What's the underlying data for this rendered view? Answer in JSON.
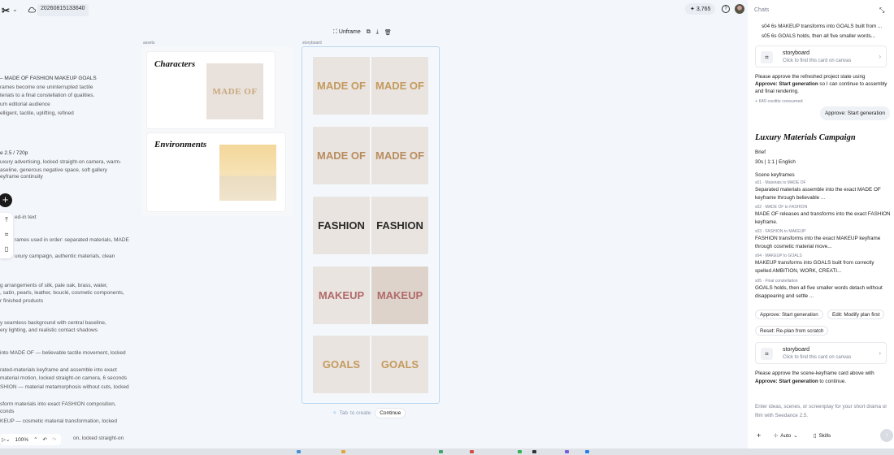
{
  "topbar": {
    "project_id": "20260815133640",
    "credits": "3,765"
  },
  "doc": {
    "lines": [
      "– MADE OF FASHION MAKEUP GOALS",
      "rames become one uninterrupted tactile",
      "terials to a final constellation of qualities.",
      "um editorial audience",
      "elligent, tactile, uplifting, refined",
      "e 2.5 / 720p",
      "uxury advertising, locked straight-on camera, warm-",
      "aseline, generous negative space, soft gallery",
      "eyframe continuity",
      "ed-in text",
      "rames used in order: separated materials, MADE",
      "uxury campaign, authentic materials, clean",
      "g arrangements of silk, pale oak, brass, water,",
      ", satin, pearls, leather, bouclé, cosmetic components,",
      "r finished products",
      "y seamless background with central baseline,",
      "ery lighting, and realistic contact shadows",
      "into MADE OF — believable tactile movement, locked",
      "rated-materials keyframe and assemble into exact",
      "material motion, locked straight-on camera, 6 seconds",
      "SHION — material metamorphosis without cuts, locked",
      "sform materials into exact FASHION composition,",
      "conds",
      "KEUP — cosmetic material transformation, locked",
      "on, locked straight-on"
    ]
  },
  "canvas": {
    "assets_label": "assets",
    "storyboard_label": "storyboard",
    "characters_title": "Characters",
    "environments_title": "Environments",
    "characters_thumb_text": "MADE OF",
    "frame_toolbar": {
      "unframe": "Unframe"
    },
    "tiles": [
      [
        "MADE OF",
        "MADE OF"
      ],
      [
        "MADE OF",
        "MADE OF"
      ],
      [
        "FASHION",
        "FASHION"
      ],
      [
        "MAKEUP",
        "MAKEUP"
      ],
      [
        "GOALS",
        "GOALS"
      ]
    ],
    "hint_key": "Tab",
    "hint_text": "to create",
    "continue_label": "Continue"
  },
  "zoom": {
    "level": "100%"
  },
  "chat": {
    "title": "Chats",
    "line_s04": "s04 6s MAKEUP transforms into GOALS built from ...",
    "line_s05": "s05 6s GOALS holds, then all five smaller words...",
    "sb_card_title": "storyboard",
    "sb_card_sub": "Click to find this card on canvas",
    "approve_msg_a": "Please approve the refreshed project state using",
    "approve_msg_b_bold": "Approve: Start generation",
    "approve_msg_b_rest": " so I can continue to assembly",
    "approve_msg_c": "and final rendering.",
    "credits_consumed": "640 credits consumed",
    "user_bubble": "Approve: Start generation",
    "campaign_title": "Luxury Materials Campaign",
    "brief_label": "Brief",
    "brief_value": "30s | 1:1 | English",
    "keyframes_label": "Scene keyframes",
    "scenes": [
      {
        "id": "s01 · Materials to MADE OF",
        "desc": "Separated materials assemble into the exact MADE OF keyframe through believable ..."
      },
      {
        "id": "s02 · MADE OF to FASHION",
        "desc": "MADE OF releases and transforms into the exact FASHION keyframe."
      },
      {
        "id": "s03 · FASHION to MAKEUP",
        "desc": "FASHION transforms into the exact MAKEUP keyframe through cosmetic material move..."
      },
      {
        "id": "s04 · MAKEUP to GOALS",
        "desc": "MAKEUP transforms into GOALS built from correctly spelled AMBITION, WORK, CREATI..."
      },
      {
        "id": "s05 · Final constellation",
        "desc": "GOALS holds, then all five smaller words detach without disappearing and settle ..."
      }
    ],
    "action_approve": "Approve: Start generation",
    "action_edit": "Edit: Modify plan first",
    "action_reset": "Reset: Re-plan from scratch",
    "final_msg_a": "Please approve the scene-keyframe card above with",
    "final_msg_b_bold": "Approve: Start generation",
    "final_msg_b_rest": " to continue.",
    "input_placeholder_1": "Enter ideas, scenes, or screenplay for your short drama or",
    "input_placeholder_2": "film with Seedance 2.5.",
    "mode_label": "Auto",
    "skills_label": "Skills"
  },
  "colors": {
    "background": "#f3f6fb",
    "storyboard_border": "#b9d8f0",
    "accent": "#1a1a1a"
  }
}
